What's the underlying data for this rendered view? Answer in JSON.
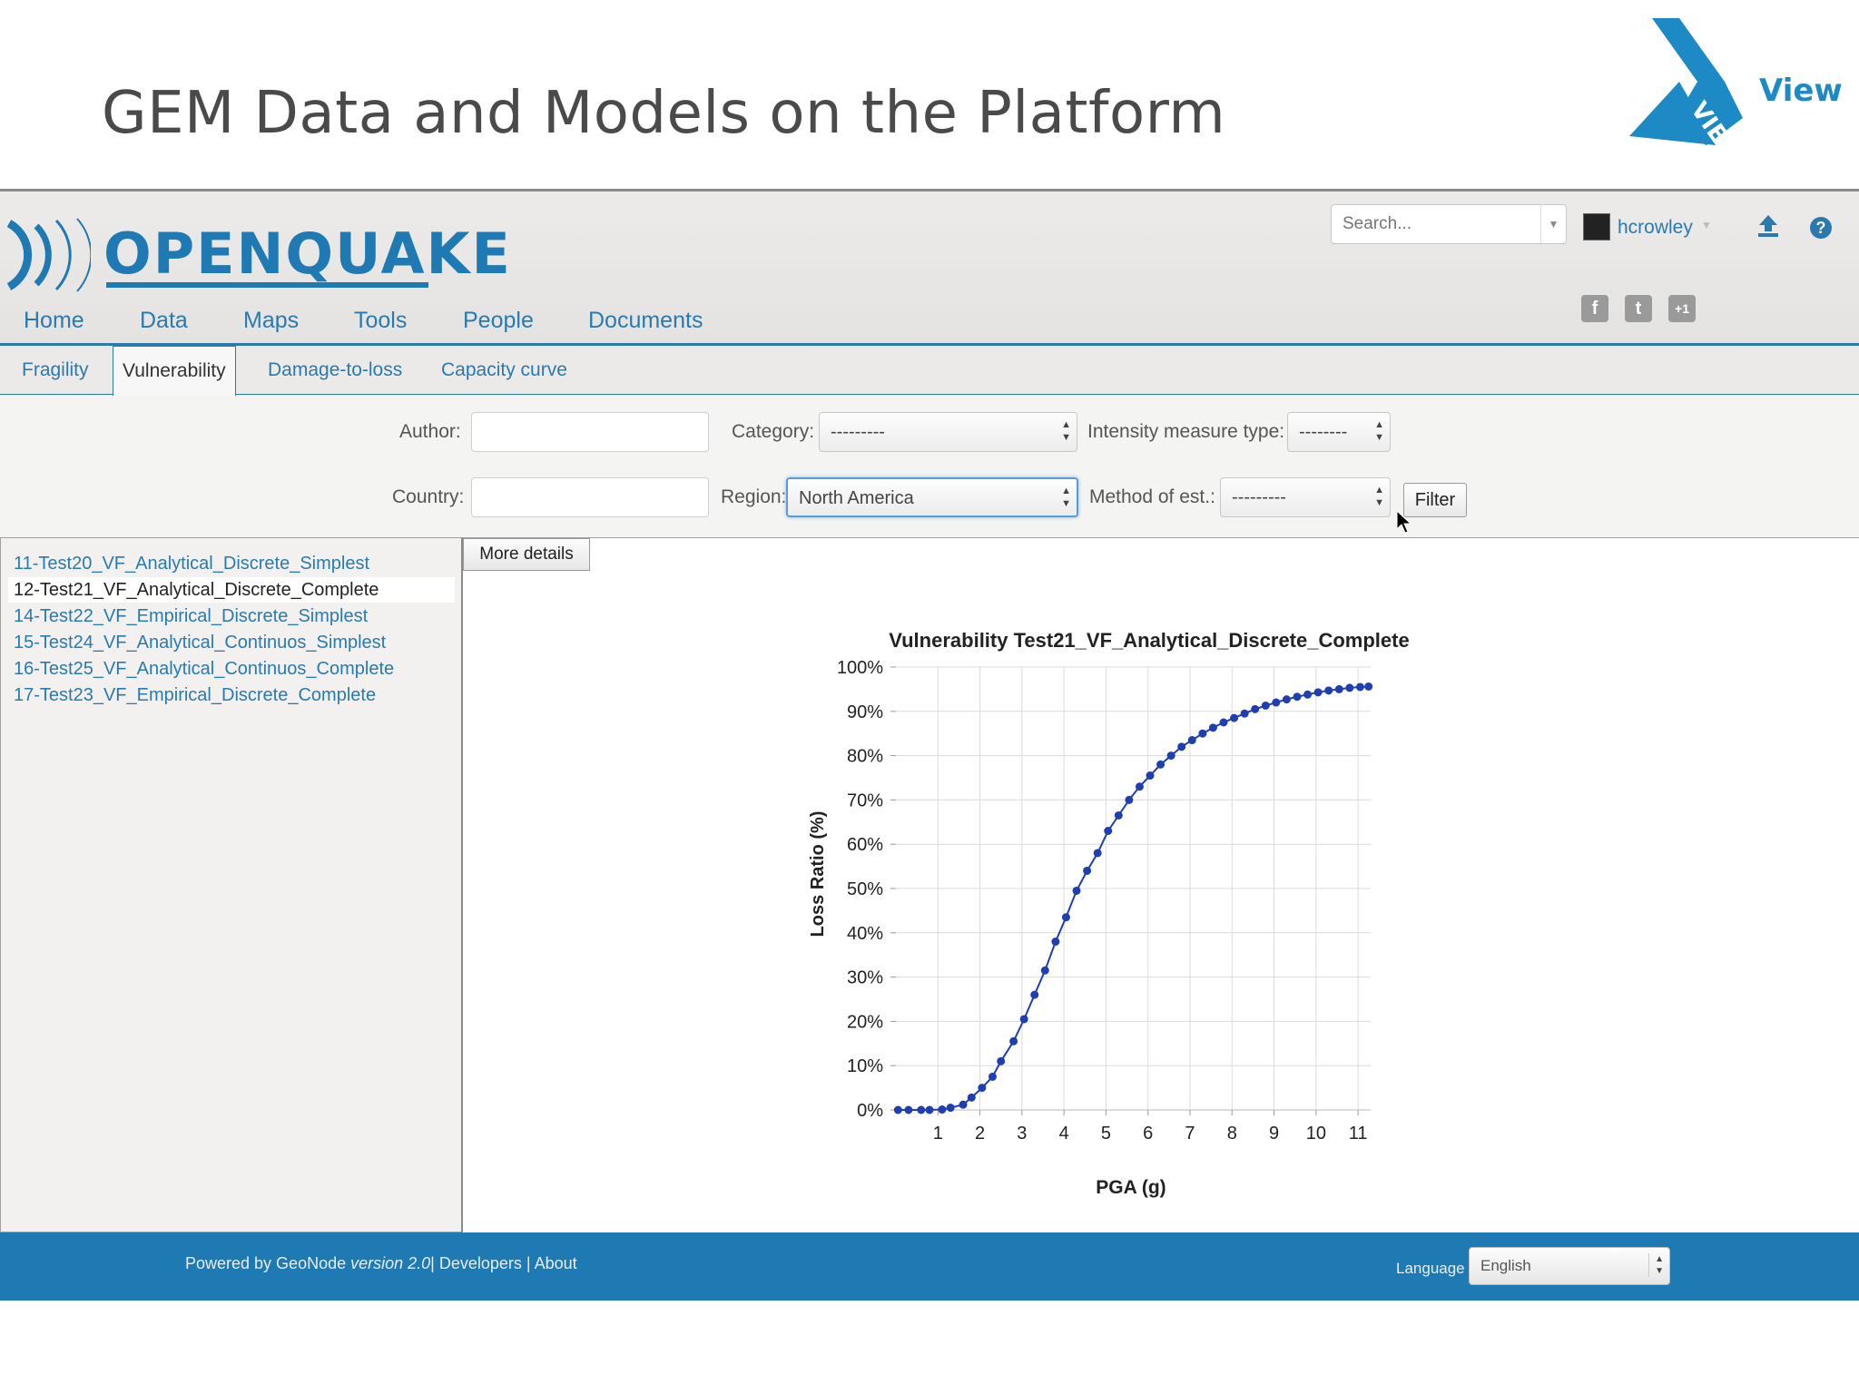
{
  "slide": {
    "title": "GEM Data and Models on the Platform",
    "logo_word": "View"
  },
  "header": {
    "brand": "OPENQUAKE",
    "search_placeholder": "Search...",
    "username": "hcrowley",
    "social": [
      "f",
      "t",
      "+1"
    ]
  },
  "nav": {
    "items": [
      "Home",
      "Data",
      "Maps",
      "Tools",
      "People",
      "Documents"
    ]
  },
  "subtabs": {
    "items": [
      "Fragility",
      "Vulnerability",
      "Damage-to-loss",
      "Capacity curve"
    ],
    "active": "Vulnerability"
  },
  "filters": {
    "author_label": "Author:",
    "author_value": "",
    "category_label": "Category:",
    "category_value": "---------",
    "imt_label": "Intensity measure type:",
    "imt_value": "--------",
    "country_label": "Country:",
    "country_value": "",
    "region_label": "Region:",
    "region_value": "North America",
    "method_label": "Method of est.:",
    "method_value": "---------",
    "filter_button": "Filter"
  },
  "list": {
    "items": [
      "11-Test20_VF_Analytical_Discrete_Simplest",
      "12-Test21_VF_Analytical_Discrete_Complete",
      "14-Test22_VF_Empirical_Discrete_Simplest",
      "15-Test24_VF_Analytical_Continuos_Simplest",
      "16-Test25_VF_Analytical_Continuos_Complete",
      "17-Test23_VF_Empirical_Discrete_Complete"
    ],
    "selected_index": 1
  },
  "more_details": "More details",
  "chart_data": {
    "type": "line",
    "title": "Vulnerability Test21_VF_Analytical_Discrete_Complete",
    "xlabel": "PGA (g)",
    "ylabel": "Loss Ratio (%)",
    "xlim": [
      0,
      11.3
    ],
    "ylim": [
      0,
      100
    ],
    "x_ticks": [
      "1",
      "2",
      "3",
      "4",
      "5",
      "6",
      "7",
      "8",
      "9",
      "10",
      "11"
    ],
    "y_ticks": [
      "0%",
      "10%",
      "20%",
      "30%",
      "40%",
      "50%",
      "60%",
      "70%",
      "80%",
      "90%",
      "100%"
    ],
    "grid": true,
    "series_color": "#1f3fb0",
    "x": [
      0.05,
      0.3,
      0.6,
      0.8,
      1.1,
      1.3,
      1.6,
      1.8,
      2.05,
      2.3,
      2.5,
      2.8,
      3.05,
      3.3,
      3.55,
      3.8,
      4.05,
      4.3,
      4.55,
      4.8,
      5.05,
      5.3,
      5.55,
      5.8,
      6.05,
      6.3,
      6.55,
      6.8,
      7.05,
      7.3,
      7.55,
      7.8,
      8.05,
      8.3,
      8.55,
      8.8,
      9.05,
      9.3,
      9.55,
      9.8,
      10.05,
      10.3,
      10.55,
      10.8,
      11.05,
      11.25
    ],
    "y": [
      0,
      0,
      0,
      0,
      0.1,
      0.5,
      1.2,
      2.8,
      5,
      7.5,
      11,
      15.5,
      20.5,
      26,
      31.5,
      38,
      43.5,
      49.5,
      54,
      58,
      63,
      66.5,
      70,
      73,
      75.5,
      78,
      80,
      82,
      83.5,
      85,
      86.3,
      87.5,
      88.5,
      89.5,
      90.5,
      91.3,
      92,
      92.7,
      93.3,
      93.8,
      94.3,
      94.7,
      95,
      95.3,
      95.5,
      95.6
    ]
  },
  "footer": {
    "powered_prefix": "Powered by GeoNode ",
    "version": "version 2.0",
    "links": "| Developers | About",
    "language_label": "Language",
    "language_value": "English"
  },
  "colors": {
    "brand_blue": "#1f7ab4",
    "link_blue": "#2a7ab0"
  }
}
